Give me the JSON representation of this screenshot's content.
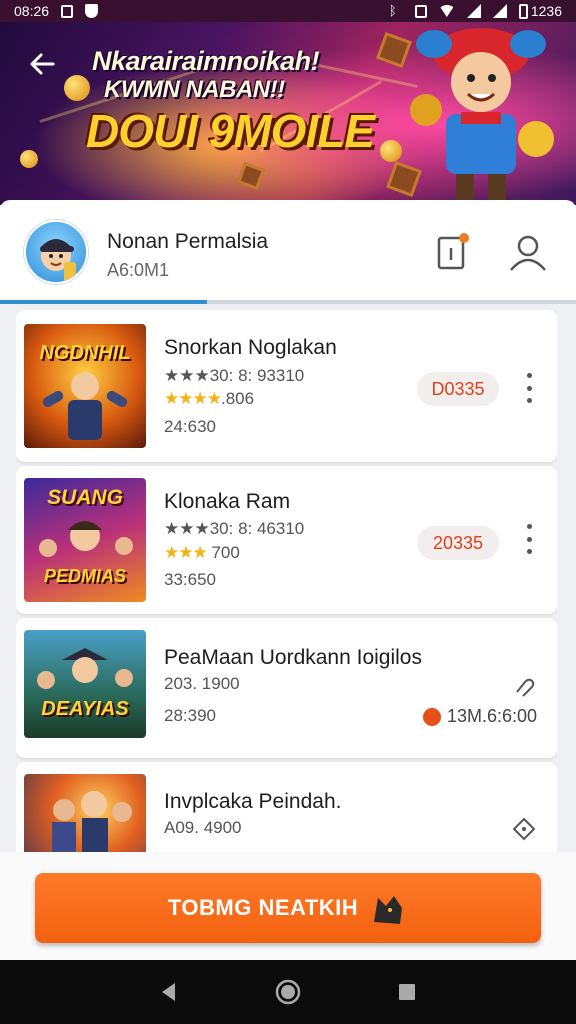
{
  "status_bar": {
    "time": "08:26",
    "battery": "1236"
  },
  "banner": {
    "line1": "Nkarairaimnoikah!",
    "line2": "KWMN NABAN!!",
    "line3": "DOUI 9MOILE"
  },
  "profile": {
    "name": "Nonan Permalsia",
    "subtitle": "A6:0M1"
  },
  "progress": 0.36,
  "games": [
    {
      "title": "Snorkan Noglakan",
      "rating_text": "★★★30: 8: 93310",
      "stars": "★★★★",
      "score": ".806",
      "extra": "24:630",
      "price": "D0335",
      "thumb_title": "NGDNHIL",
      "action": "more"
    },
    {
      "title": "Klonaka Ram",
      "rating_text": "★★★30: 8: 46310",
      "stars": "★★★",
      "score": " 700",
      "extra": "33:650",
      "price": "20335",
      "thumb_title": "SUANG",
      "thumb_sub": "PEDMIAS",
      "action": "more"
    },
    {
      "title": "PeaMaan Uordkann Ioigilos",
      "rating_text": "203. 1900",
      "extra": "28:390",
      "time": "13M.6:6:00",
      "thumb_title": "DEAYIAS",
      "action": "link"
    },
    {
      "title": "Invplcaka Peindah.",
      "rating_text": "A09. 4900",
      "thumb_title": "",
      "action": "diamond"
    }
  ],
  "cta": {
    "label": "TOBMG NEATKIH"
  },
  "colors": {
    "accent": "#f26110",
    "price": "#e0401a",
    "progress": "#2f8fd0",
    "star": "#f3b316"
  }
}
